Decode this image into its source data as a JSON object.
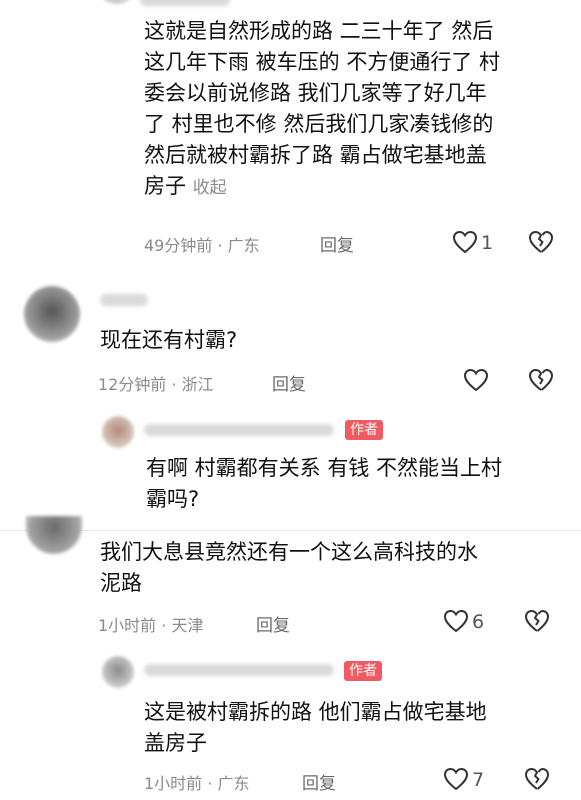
{
  "comments": [
    {
      "text": "这就是自然形成的路 二三十年了 然后这几年下雨 被车压的 不方便通行了 村委会以前说修路 我们几家等了好几年了 村里也不修 然后我们几家凑钱修的然后就被村霸拆了路 霸占做宅基地盖房子",
      "lines": [
        "这就是自然形成的路 二三十年了 然后",
        "这几年下雨 被车压的 不方便通行了 村",
        "委会以前说修路 我们几家等了好几年",
        "了 村里也不修 然后我们几家凑钱修的",
        "然后就被村霸拆了路 霸占做宅基地盖",
        "房子"
      ],
      "collapse": "收起",
      "time": "49分钟前",
      "location": "广东",
      "reply_label": "回复",
      "likes": "1"
    },
    {
      "text": "现在还有村霸?",
      "time": "12分钟前",
      "location": "浙江",
      "reply_label": "回复",
      "likes": ""
    },
    {
      "author_tag": "作者",
      "text": "有啊 村霸都有关系 有钱 不然能当上村霸吗?",
      "lines": [
        "有啊 村霸都有关系 有钱 不然能当上村",
        "霸吗?"
      ]
    },
    {
      "text": "我们大息县竟然还有一个这么高科技的水泥路",
      "lines": [
        "我们大息县竟然还有一个这么高科技的水",
        "泥路"
      ],
      "time": "1小时前",
      "location": "天津",
      "reply_label": "回复",
      "likes": "6"
    },
    {
      "author_tag": "作者",
      "text": "这是被村霸拆的路 他们霸占做宅基地盖房子",
      "lines": [
        "这是被村霸拆的路 他们霸占做宅基地",
        "盖房子"
      ],
      "time": "1小时前",
      "location": "广东",
      "reply_label": "回复",
      "likes": "7"
    }
  ],
  "separator": "·",
  "icons": {
    "like": "heart-outline-icon",
    "dislike": "broken-heart-icon"
  },
  "colors": {
    "author_tag": "#f05a63",
    "meta": "#8a8b91",
    "text": "#111111"
  }
}
